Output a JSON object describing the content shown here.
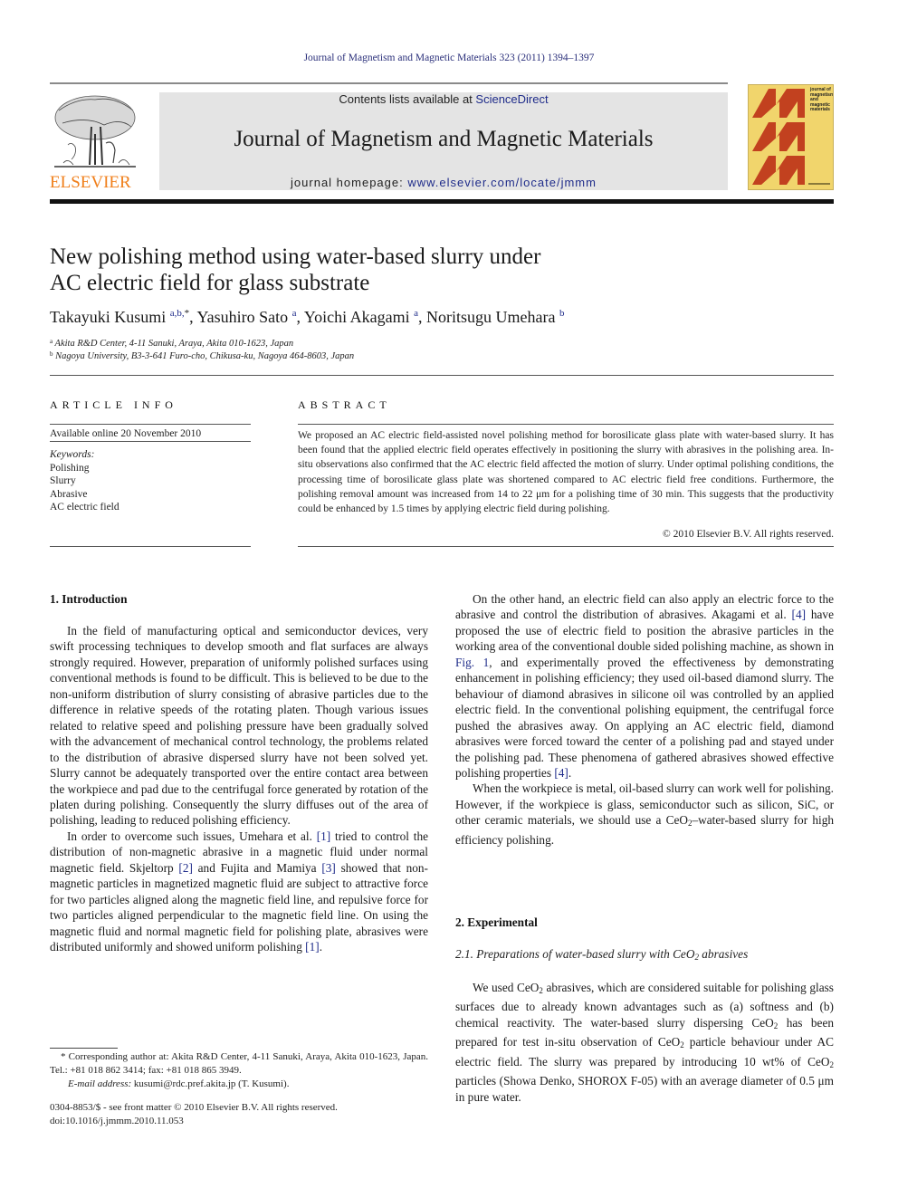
{
  "header": {
    "running_head": "Journal of Magnetism and Magnetic Materials 323 (2011) 1394–1397",
    "publisher_logo_text": "ELSEVIER",
    "contents_prefix": "Contents lists available at ",
    "contents_link": "ScienceDirect",
    "journal_title": "Journal of Magnetism and Magnetic Materials",
    "homepage_prefix": "journal homepage: ",
    "homepage_link": "www.elsevier.com/locate/jmmm",
    "cover_text": "journal of magnetism and magnetic materials",
    "cover_letters": [
      "M",
      "M",
      "M"
    ],
    "colors": {
      "elsevier_orange": "#f07f1b",
      "link_blue": "#1f2c8a",
      "cover_yellow": "#f1d56c",
      "cover_red": "#c2411f"
    }
  },
  "article": {
    "title_line1": "New polishing method using water-based slurry under",
    "title_line2": "AC electric field for glass substrate",
    "authors": [
      {
        "name": "Takayuki Kusumi",
        "sup": "a,b,",
        "mark": "*"
      },
      {
        "name": "Yasuhiro Sato",
        "sup": "a"
      },
      {
        "name": "Yoichi Akagami",
        "sup": "a"
      },
      {
        "name": "Noritsugu Umehara",
        "sup": "b"
      }
    ],
    "affiliations": [
      {
        "key": "a",
        "text": "Akita R&D Center, 4-11 Sanuki, Araya, Akita 010-1623, Japan"
      },
      {
        "key": "b",
        "text": "Nagoya University, B3-3-641 Furo-cho, Chikusa-ku, Nagoya 464-8603, Japan"
      }
    ]
  },
  "article_info": {
    "heading": "ARTICLE INFO",
    "available_online": "Available online 20 November 2010",
    "keywords_label": "Keywords:",
    "keywords": [
      "Polishing",
      "Slurry",
      "Abrasive",
      "AC electric field"
    ]
  },
  "abstract": {
    "heading": "ABSTRACT",
    "text": "We proposed an AC electric field-assisted novel polishing method for borosilicate glass plate with water-based slurry. It has been found that the applied electric field operates effectively in positioning the slurry with abrasives in the polishing area. In-situ observations also confirmed that the AC electric field affected the motion of slurry. Under optimal polishing conditions, the processing time of borosilicate glass plate was shortened compared to AC electric field free conditions. Furthermore, the polishing removal amount was increased from 14 to 22 μm for a polishing time of 30 min. This suggests that the productivity could be enhanced by 1.5 times by applying electric field during polishing.",
    "copyright": "© 2010 Elsevier B.V. All rights reserved."
  },
  "body": {
    "section1_heading": "1.  Introduction",
    "s1_p1": "In the field of manufacturing optical and semiconductor devices, very swift processing techniques to develop smooth and flat surfaces are always strongly required. However, preparation of uniformly polished surfaces using conventional methods is found to be difficult. This is believed to be due to the non-uniform distribution of slurry consisting of abrasive particles due to the difference in relative speeds of the rotating platen. Though various issues related to relative speed and polishing pressure have been gradually solved with the advancement of mechanical control technology, the problems related to the distribution of abrasive dispersed slurry have not been solved yet. Slurry cannot be adequately transported over the entire contact area between the workpiece and pad due to the centrifugal force generated by rotation of the platen during polishing. Consequently the slurry diffuses out of the area of polishing, leading to reduced polishing efficiency.",
    "s1_p2_a": "In order to overcome such issues, Umehara et al. ",
    "ref1": "[1]",
    "s1_p2_b": " tried to control the distribution of non-magnetic abrasive in a magnetic fluid under normal magnetic field. Skjeltorp ",
    "ref2": "[2]",
    "s1_p2_c": " and Fujita and Mamiya ",
    "ref3": "[3]",
    "s1_p2_d": " showed that non-magnetic particles in magnetized magnetic fluid are subject to attractive force for two particles aligned along the magnetic field line, and repulsive force for two particles aligned perpendicular to the magnetic field line. On using the magnetic fluid and normal magnetic field for polishing plate, abrasives were distributed uniformly and showed uniform polishing ",
    "s1_p2_e": ".",
    "s1_p3_a": "On the other hand, an electric field can also apply an electric force to the abrasive and control the distribution of abrasives. Akagami et al. ",
    "ref4": "[4]",
    "s1_p3_b": " have proposed the use of electric field to position the abrasive particles in the working area of the conventional double sided polishing machine, as shown in ",
    "fig1": "Fig. 1",
    "s1_p3_c": ", and experimentally proved the effectiveness by demonstrating enhancement in polishing efficiency; they used oil-based diamond slurry. The behaviour of diamond abrasives in silicone oil was controlled by an applied electric field. In the conventional polishing equipment, the centrifugal force pushed the abrasives away. On applying an AC electric field, diamond abrasives were forced toward the center of a polishing pad and stayed under the polishing pad. These phenomena of gathered abrasives showed effective polishing properties ",
    "s1_p3_d": ".",
    "s1_p4_a": "When the workpiece is metal, oil-based slurry can work well for polishing. However, if the workpiece is glass, semiconductor such as silicon, SiC, or other ceramic materials, we should use a CeO",
    "s1_p4_b": "–water-based slurry for high efficiency polishing.",
    "section2_heading": "2.  Experimental",
    "sub21_a": "2.1.  Preparations of water-based slurry with CeO",
    "sub21_b": " abrasives",
    "s2_p1_a": "We used CeO",
    "s2_p1_b": " abrasives, which are considered suitable for polishing glass surfaces due to already known advantages such as (a) softness and (b) chemical reactivity. The water-based slurry dispersing CeO",
    "s2_p1_c": " has been prepared for test in-situ observation of CeO",
    "s2_p1_d": " particle behaviour under AC electric field. The slurry was prepared by introducing 10 wt% of CeO",
    "s2_p1_e": " particles (Showa Denko, SHOROX F-05) with an average diameter of 0.5 μm in pure water.",
    "subscript_2": "2"
  },
  "footnotes": {
    "corresponding": "* Corresponding author at: Akita R&D Center, 4-11 Sanuki, Araya, Akita 010-1623, Japan. Tel.: +81 018 862 3414; fax: +81 018 865 3949.",
    "email_label": "E-mail address: ",
    "email": "kusumi@rdc.pref.akita.jp",
    "email_suffix": " (T. Kusumi).",
    "front_matter": "0304-8853/$ - see front matter © 2010 Elsevier B.V. All rights reserved.",
    "doi": "doi:10.1016/j.jmmm.2010.11.053"
  }
}
